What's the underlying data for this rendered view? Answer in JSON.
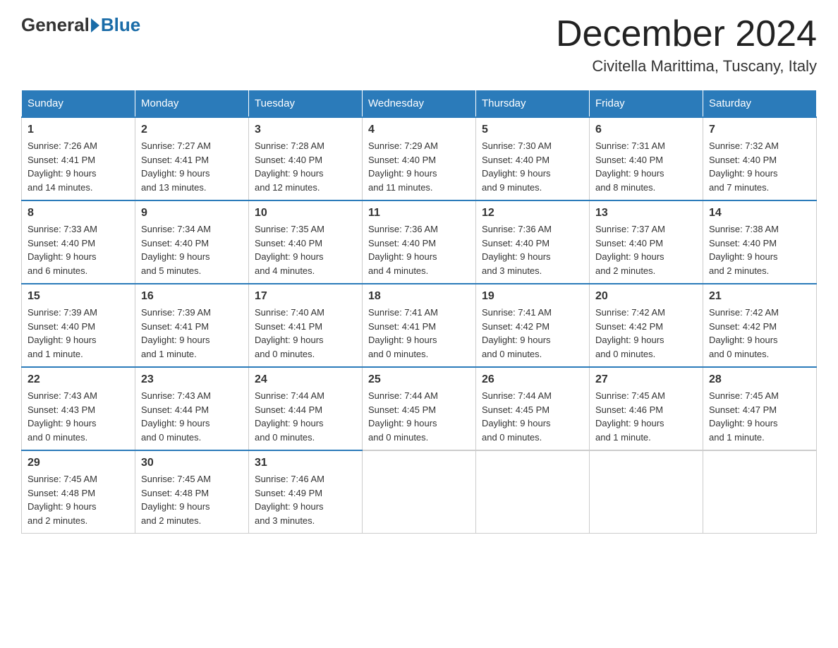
{
  "header": {
    "logo_general": "General",
    "logo_blue": "Blue",
    "month_title": "December 2024",
    "location": "Civitella Marittima, Tuscany, Italy"
  },
  "days_of_week": [
    "Sunday",
    "Monday",
    "Tuesday",
    "Wednesday",
    "Thursday",
    "Friday",
    "Saturday"
  ],
  "weeks": [
    [
      {
        "day": "1",
        "sunrise": "7:26 AM",
        "sunset": "4:41 PM",
        "daylight": "9 hours and 14 minutes."
      },
      {
        "day": "2",
        "sunrise": "7:27 AM",
        "sunset": "4:41 PM",
        "daylight": "9 hours and 13 minutes."
      },
      {
        "day": "3",
        "sunrise": "7:28 AM",
        "sunset": "4:40 PM",
        "daylight": "9 hours and 12 minutes."
      },
      {
        "day": "4",
        "sunrise": "7:29 AM",
        "sunset": "4:40 PM",
        "daylight": "9 hours and 11 minutes."
      },
      {
        "day": "5",
        "sunrise": "7:30 AM",
        "sunset": "4:40 PM",
        "daylight": "9 hours and 9 minutes."
      },
      {
        "day": "6",
        "sunrise": "7:31 AM",
        "sunset": "4:40 PM",
        "daylight": "9 hours and 8 minutes."
      },
      {
        "day": "7",
        "sunrise": "7:32 AM",
        "sunset": "4:40 PM",
        "daylight": "9 hours and 7 minutes."
      }
    ],
    [
      {
        "day": "8",
        "sunrise": "7:33 AM",
        "sunset": "4:40 PM",
        "daylight": "9 hours and 6 minutes."
      },
      {
        "day": "9",
        "sunrise": "7:34 AM",
        "sunset": "4:40 PM",
        "daylight": "9 hours and 5 minutes."
      },
      {
        "day": "10",
        "sunrise": "7:35 AM",
        "sunset": "4:40 PM",
        "daylight": "9 hours and 4 minutes."
      },
      {
        "day": "11",
        "sunrise": "7:36 AM",
        "sunset": "4:40 PM",
        "daylight": "9 hours and 4 minutes."
      },
      {
        "day": "12",
        "sunrise": "7:36 AM",
        "sunset": "4:40 PM",
        "daylight": "9 hours and 3 minutes."
      },
      {
        "day": "13",
        "sunrise": "7:37 AM",
        "sunset": "4:40 PM",
        "daylight": "9 hours and 2 minutes."
      },
      {
        "day": "14",
        "sunrise": "7:38 AM",
        "sunset": "4:40 PM",
        "daylight": "9 hours and 2 minutes."
      }
    ],
    [
      {
        "day": "15",
        "sunrise": "7:39 AM",
        "sunset": "4:40 PM",
        "daylight": "9 hours and 1 minute."
      },
      {
        "day": "16",
        "sunrise": "7:39 AM",
        "sunset": "4:41 PM",
        "daylight": "9 hours and 1 minute."
      },
      {
        "day": "17",
        "sunrise": "7:40 AM",
        "sunset": "4:41 PM",
        "daylight": "9 hours and 0 minutes."
      },
      {
        "day": "18",
        "sunrise": "7:41 AM",
        "sunset": "4:41 PM",
        "daylight": "9 hours and 0 minutes."
      },
      {
        "day": "19",
        "sunrise": "7:41 AM",
        "sunset": "4:42 PM",
        "daylight": "9 hours and 0 minutes."
      },
      {
        "day": "20",
        "sunrise": "7:42 AM",
        "sunset": "4:42 PM",
        "daylight": "9 hours and 0 minutes."
      },
      {
        "day": "21",
        "sunrise": "7:42 AM",
        "sunset": "4:42 PM",
        "daylight": "9 hours and 0 minutes."
      }
    ],
    [
      {
        "day": "22",
        "sunrise": "7:43 AM",
        "sunset": "4:43 PM",
        "daylight": "9 hours and 0 minutes."
      },
      {
        "day": "23",
        "sunrise": "7:43 AM",
        "sunset": "4:44 PM",
        "daylight": "9 hours and 0 minutes."
      },
      {
        "day": "24",
        "sunrise": "7:44 AM",
        "sunset": "4:44 PM",
        "daylight": "9 hours and 0 minutes."
      },
      {
        "day": "25",
        "sunrise": "7:44 AM",
        "sunset": "4:45 PM",
        "daylight": "9 hours and 0 minutes."
      },
      {
        "day": "26",
        "sunrise": "7:44 AM",
        "sunset": "4:45 PM",
        "daylight": "9 hours and 0 minutes."
      },
      {
        "day": "27",
        "sunrise": "7:45 AM",
        "sunset": "4:46 PM",
        "daylight": "9 hours and 1 minute."
      },
      {
        "day": "28",
        "sunrise": "7:45 AM",
        "sunset": "4:47 PM",
        "daylight": "9 hours and 1 minute."
      }
    ],
    [
      {
        "day": "29",
        "sunrise": "7:45 AM",
        "sunset": "4:48 PM",
        "daylight": "9 hours and 2 minutes."
      },
      {
        "day": "30",
        "sunrise": "7:45 AM",
        "sunset": "4:48 PM",
        "daylight": "9 hours and 2 minutes."
      },
      {
        "day": "31",
        "sunrise": "7:46 AM",
        "sunset": "4:49 PM",
        "daylight": "9 hours and 3 minutes."
      },
      null,
      null,
      null,
      null
    ]
  ],
  "labels": {
    "sunrise": "Sunrise:",
    "sunset": "Sunset:",
    "daylight": "Daylight:"
  }
}
